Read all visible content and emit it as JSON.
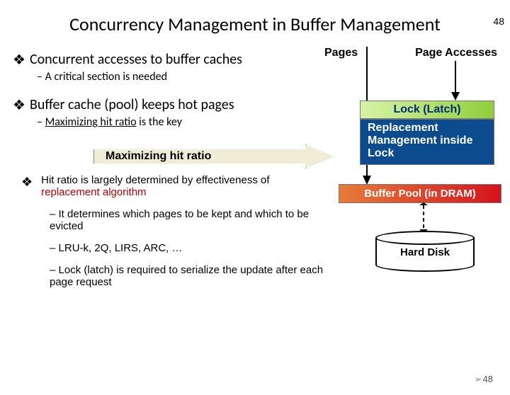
{
  "page_number_top": "48",
  "page_number_bottom": "48",
  "title": "Concurrency Management in Buffer Management",
  "b1": {
    "text": "Concurrent accesses to buffer caches",
    "sub": "A critical section is needed"
  },
  "b2": {
    "text": "Buffer  cache (pool) keeps hot pages",
    "sub_pre": "Maximizing hit ratio",
    "sub_post": " is the key"
  },
  "b3": {
    "pre": "Hit ratio is largely determined by effectiveness of ",
    "red": "replacement algorithm",
    "s1": "It determines which pages to be kept and which to be evicted",
    "s2": "LRU-k, 2Q, LIRS, ARC, …",
    "s3": "Lock (latch) is  required to serialize the update after each page request"
  },
  "diagram": {
    "pages": "Pages",
    "page_accesses": "Page Accesses",
    "lock": "Lock (Latch)",
    "replacement": "Replacement Management inside Lock",
    "max_arrow": "Maximizing hit ratio",
    "pool": "Buffer Pool (in DRAM)",
    "disk": "Hard Disk"
  }
}
